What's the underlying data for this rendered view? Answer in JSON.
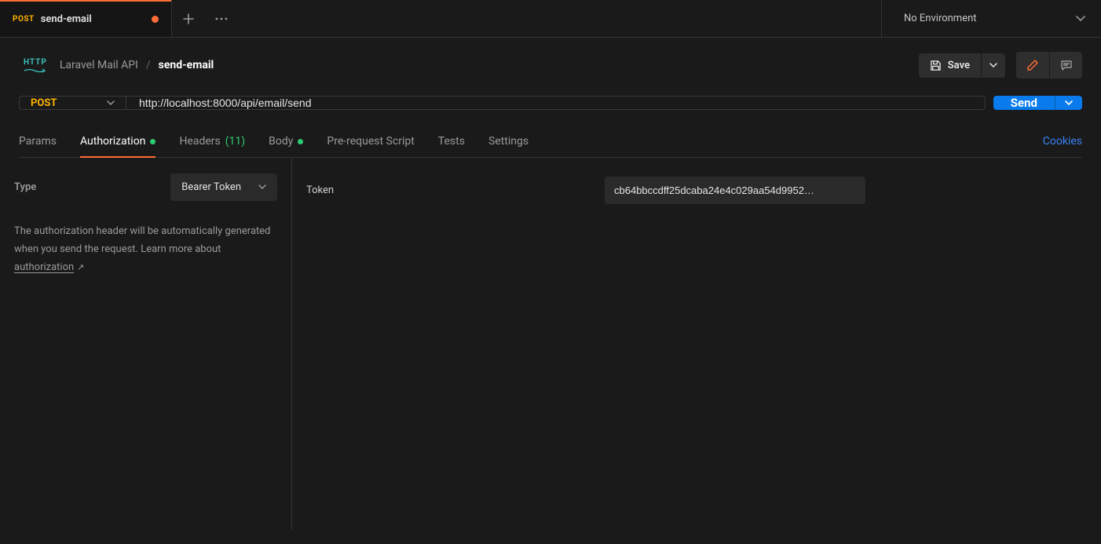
{
  "tab": {
    "method": "POST",
    "title": "send-email"
  },
  "environment": {
    "label": "No Environment"
  },
  "breadcrumb": {
    "http_badge": "HTTP",
    "collection": "Laravel Mail API",
    "sep": "/",
    "request": "send-email"
  },
  "actions": {
    "save": "Save"
  },
  "request": {
    "method": "POST",
    "url": "http://localhost:8000/api/email/send",
    "send": "Send"
  },
  "tabs": {
    "params": "Params",
    "authorization": "Authorization",
    "headers_label": "Headers",
    "headers_count": "(11)",
    "body": "Body",
    "prerequest": "Pre-request Script",
    "tests": "Tests",
    "settings": "Settings",
    "cookies": "Cookies"
  },
  "auth": {
    "type_label": "Type",
    "type_value": "Bearer Token",
    "help_text": "The authorization header will be automatically generated when you send the request. Learn more about ",
    "help_link": "authorization",
    "token_label": "Token",
    "token_value": "cb64bbccdff25dcaba24e4c029aa54d9952…"
  }
}
